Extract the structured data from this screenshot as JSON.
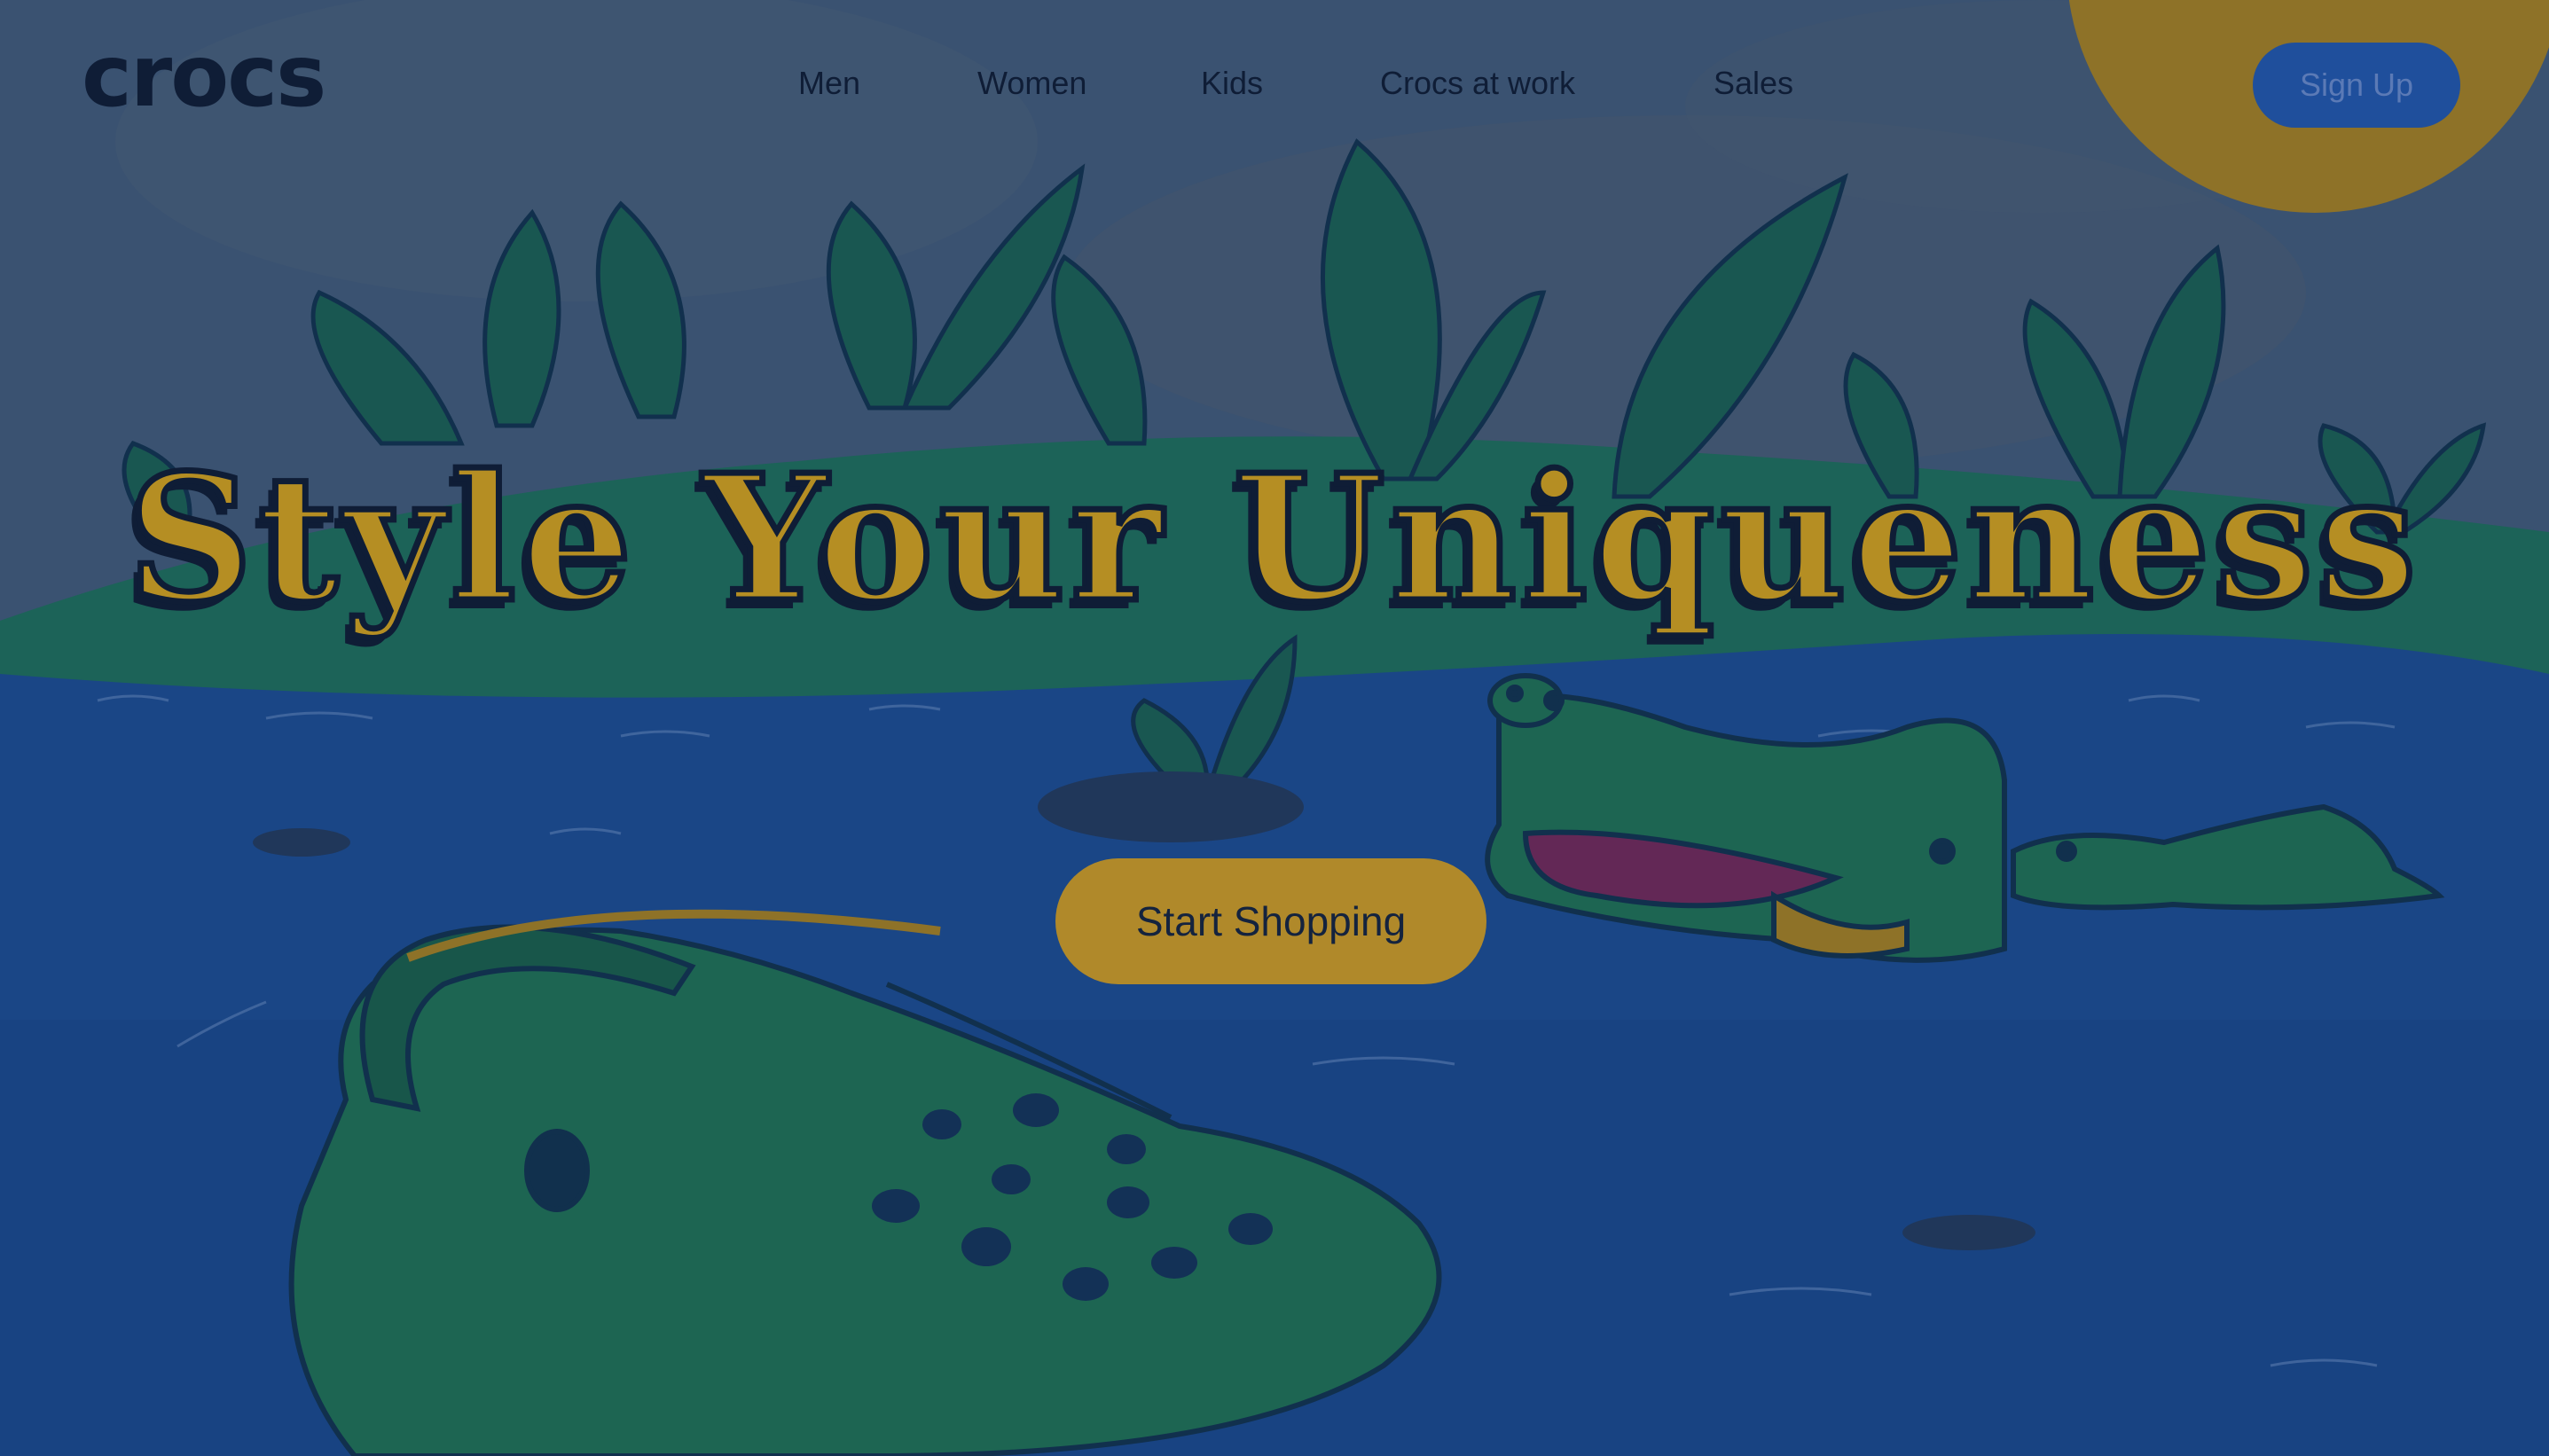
{
  "brand": {
    "logo_text": "crocs"
  },
  "nav": {
    "links": [
      "Men",
      "Women",
      "Kids",
      "Crocs at work",
      "Sales"
    ],
    "signup_label": "Sign Up"
  },
  "hero": {
    "title": "Style Your Uniqueness",
    "cta_label": "Start Shopping"
  },
  "colors": {
    "sky": "#3f5a7a",
    "water": "#1c4a8e",
    "grass": "#1f6b5a",
    "accent_yellow": "#b58e23",
    "sign_up_blue": "#1f4f9c",
    "text_dark": "#0f1d36"
  }
}
